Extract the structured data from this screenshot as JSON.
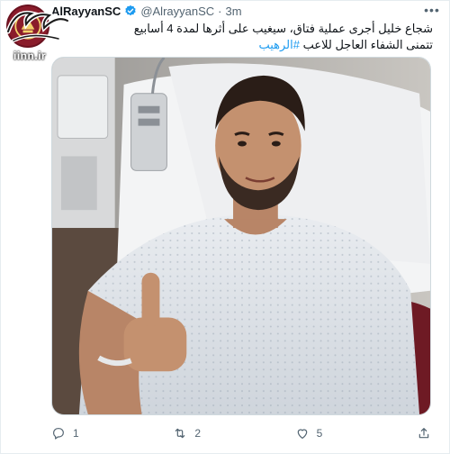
{
  "tweet": {
    "display_name": "AlRayyanSC",
    "handle": "@AlrayyanSC",
    "separator": "·",
    "time": "3m",
    "text_line1": "شجاع خليل أجرى عملية فتاق، سيغيب على أثرها لمدة 4 أسابيع",
    "text_line2": "تتمنى الشفاء العاجل للاعب",
    "hashtag": "#الرهيب",
    "replies": "1",
    "retweets": "2",
    "likes": "5"
  },
  "watermark": {
    "text": "iinn.ir"
  },
  "icons": {
    "verified": "verified-badge-icon",
    "more": "more-dots-icon",
    "reply": "reply-icon",
    "retweet": "retweet-icon",
    "like": "heart-icon",
    "share": "share-icon"
  },
  "colors": {
    "accent": "#1d9bf0",
    "club": "#8a1c2b",
    "muted": "#536471"
  }
}
